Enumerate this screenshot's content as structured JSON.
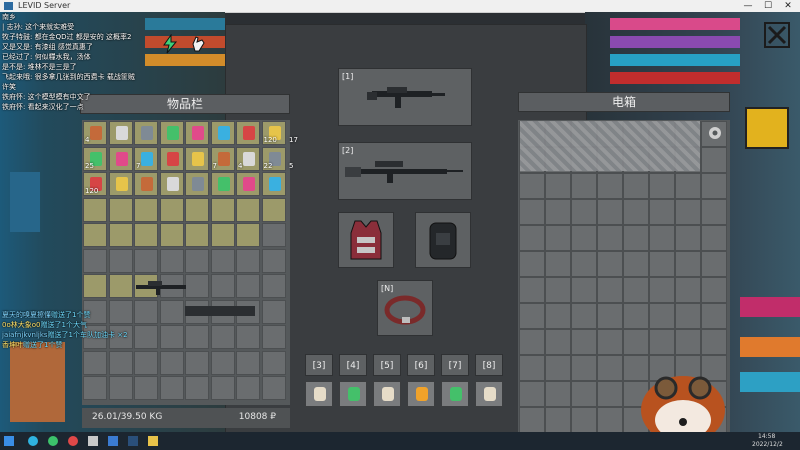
{
  "window": {
    "title": "LEVID Server"
  },
  "inventory": {
    "title": "物品栏",
    "weight": "26.01/39.50 KG",
    "money": "10808 ₽"
  },
  "storage": {
    "title": "电箱"
  },
  "equipment": {
    "slot1_label": "[1]",
    "slot2_label": "[2]",
    "slotN_label": "[N]"
  },
  "hotbar": {
    "labels": [
      "[3]",
      "[4]",
      "[5]",
      "[6]",
      "[7]",
      "[8]"
    ]
  },
  "inventory_counts": {
    "r1": [
      "4",
      "",
      "",
      "",
      "",
      "",
      "",
      "120",
      "17"
    ],
    "r2": [
      "25",
      "",
      "7",
      "",
      "",
      "7",
      "4",
      "22",
      "5"
    ],
    "r3": [
      "120",
      "",
      "",
      "",
      "",
      "",
      "",
      ""
    ]
  },
  "chat_top": [
    {
      "user": "南乡",
      "text": "",
      "color": "#ffffff"
    },
    {
      "user": "",
      "text": "| 志孙: 这个来就实难受",
      "color": "#ffffff"
    },
    {
      "user": "牧子特鼓",
      "text": "都在金QD过 都是安的 这概率2",
      "color": "#ffffff"
    },
    {
      "user": "又是又是",
      "text": "有漆组 感觉真惠了",
      "color": "#ffffff"
    },
    {
      "user": "已经过了",
      "text": "何似糧水我，汤体",
      "color": "#ffffff"
    },
    {
      "user": "是不是",
      "text": "堆林不是三是了",
      "color": "#ffffff"
    },
    {
      "user": "飞起来哦",
      "text": "很多拿几张到的西费卡 载战筐贼",
      "color": "#ffffff"
    },
    {
      "user": "许笑",
      "text": "",
      "color": "#ffffff"
    },
    {
      "user": "铁府怀",
      "text": "这个模型模有中文了",
      "color": "#ffffff"
    },
    {
      "user": "铁府怀",
      "text": "看起来汉化了一点",
      "color": "#ffffff"
    }
  ],
  "chat_bottom": [
    {
      "user": "夏天的嗅夏擦懂",
      "text": "赠送了1个赞",
      "ucolor": "#7fd5ff"
    },
    {
      "user": "0o林大象o0",
      "text": "赠送了1个大气",
      "ucolor": "#ffe36b"
    },
    {
      "user": "jaiafnjkvnljks",
      "text": "赠送了1个车队加油卡 ×2",
      "ucolor": "#7fd5ff"
    },
    {
      "user": "香坤叶",
      "text": "赠送了1个赞",
      "ucolor": "#ffe36b"
    }
  ],
  "taskbar": {
    "time": "14:58",
    "date": "2022/12/2"
  },
  "colors": {
    "accent_cyan": "#6fdcff",
    "accent_yellow": "#ffe36b",
    "panel": "#4a4d50"
  },
  "icons": [
    "lightning-icon",
    "hand-icon",
    "close-icon",
    "assault-rifle-icon",
    "sniper-rifle-icon",
    "body-armor-icon",
    "backpack-icon",
    "belt-icon",
    "settings-gear-icon"
  ]
}
